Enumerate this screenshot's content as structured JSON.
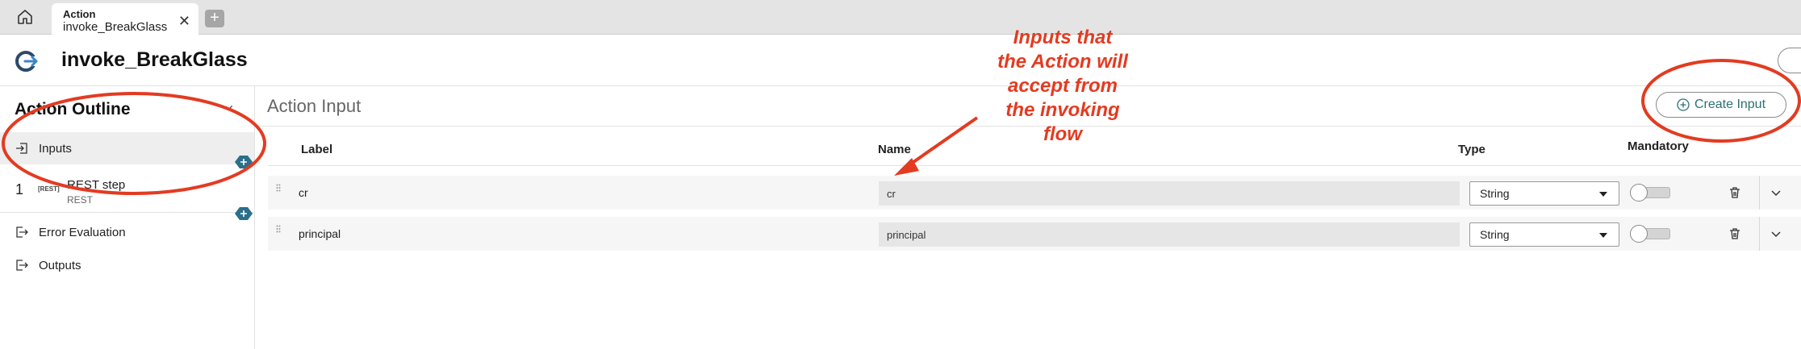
{
  "tabbar": {
    "home_icon": "home-icon",
    "tab": {
      "type": "Action",
      "name": "invoke_BreakGlass",
      "close": "✕"
    },
    "new_tab": "+"
  },
  "header": {
    "title": "invoke_BreakGlass",
    "logo_icon": "action-logo-icon"
  },
  "sidebar": {
    "title": "Action Outline",
    "collapse_glyph": "‹",
    "inputs_label": "Inputs",
    "step": {
      "number": "1",
      "tag": "[REST]",
      "name": "REST step",
      "kind": "REST"
    },
    "error_label": "Error Evaluation",
    "outputs_label": "Outputs"
  },
  "main": {
    "title": "Action Input",
    "create_label": "Create Input",
    "columns": {
      "label": "Label",
      "name": "Name",
      "type": "Type",
      "mandatory": "Mandatory"
    },
    "rows": [
      {
        "label": "cr",
        "name": "cr",
        "type": "String",
        "mandatory": false
      },
      {
        "label": "principal",
        "name": "principal",
        "type": "String",
        "mandatory": false
      }
    ]
  },
  "annotation": {
    "lines": [
      "Inputs that",
      "the Action will",
      "accept from",
      "the invoking",
      "flow"
    ],
    "color": "#e33b21"
  },
  "colors": {
    "accent": "#2e6f73",
    "add_badge": "#2b6f8a",
    "annotation": "#e33b21"
  }
}
